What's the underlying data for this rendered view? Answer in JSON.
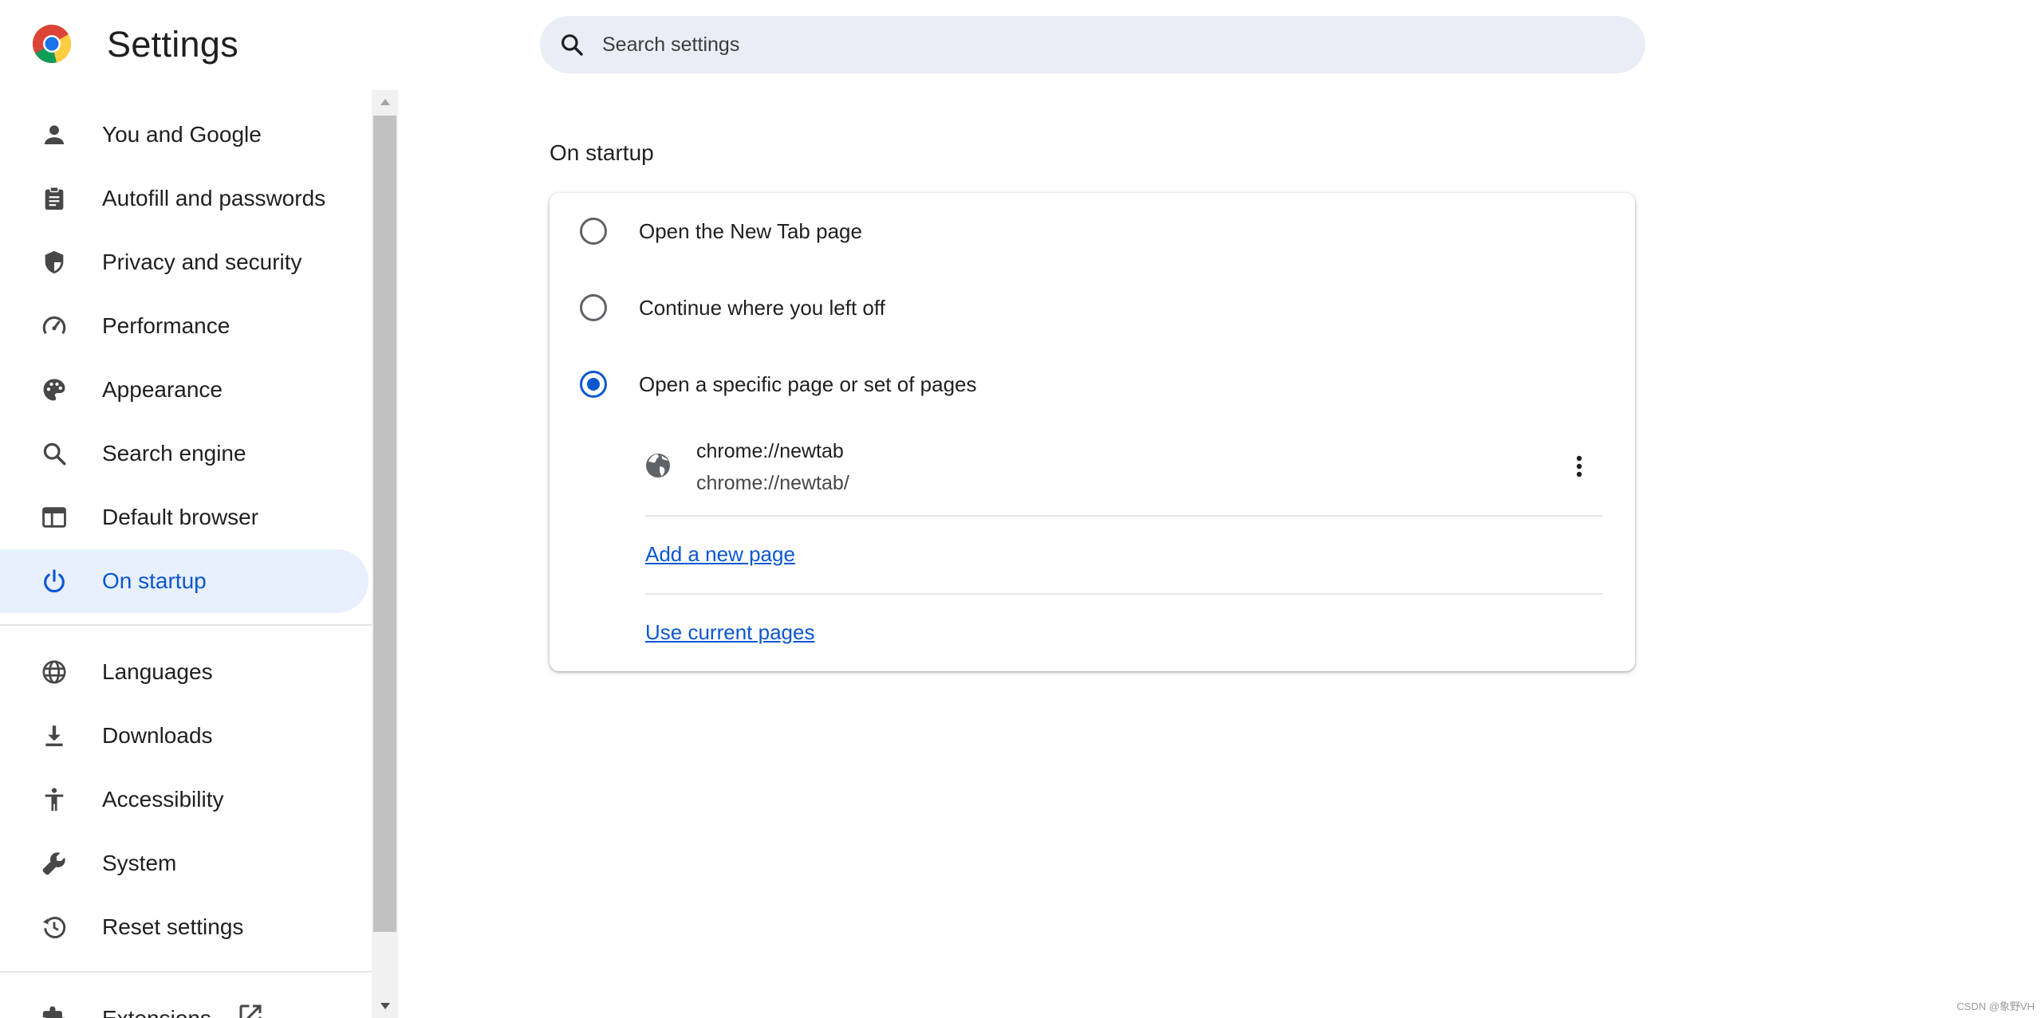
{
  "header": {
    "title": "Settings",
    "search": {
      "placeholder": "Search settings",
      "value": ""
    }
  },
  "colors": {
    "accent": "#0b57d0",
    "active_nav_bg": "#e8f0fe",
    "search_bg": "#e9eef6"
  },
  "sidebar": {
    "items": [
      {
        "label": "You and Google",
        "icon": "person-icon"
      },
      {
        "label": "Autofill and passwords",
        "icon": "clipboard-icon"
      },
      {
        "label": "Privacy and security",
        "icon": "shield-icon"
      },
      {
        "label": "Performance",
        "icon": "speedometer-icon"
      },
      {
        "label": "Appearance",
        "icon": "palette-icon"
      },
      {
        "label": "Search engine",
        "icon": "search-icon"
      },
      {
        "label": "Default browser",
        "icon": "browser-window-icon"
      },
      {
        "label": "On startup",
        "icon": "power-icon",
        "active": true
      },
      {
        "label": "Languages",
        "icon": "globe-icon"
      },
      {
        "label": "Downloads",
        "icon": "download-icon"
      },
      {
        "label": "Accessibility",
        "icon": "accessibility-icon"
      },
      {
        "label": "System",
        "icon": "wrench-icon"
      },
      {
        "label": "Reset settings",
        "icon": "history-icon"
      },
      {
        "label": "Extensions",
        "icon": "puzzle-icon"
      }
    ]
  },
  "main": {
    "section_title": "On startup",
    "options": [
      {
        "label": "Open the New Tab page",
        "checked": false
      },
      {
        "label": "Continue where you left off",
        "checked": false
      },
      {
        "label": "Open a specific page or set of pages",
        "checked": true
      }
    ],
    "pages": [
      {
        "title": "chrome://newtab",
        "url": "chrome://newtab/"
      }
    ],
    "add_page_link": "Add a new page",
    "use_current_link": "Use current pages"
  },
  "watermark": "CSDN @象野VH"
}
